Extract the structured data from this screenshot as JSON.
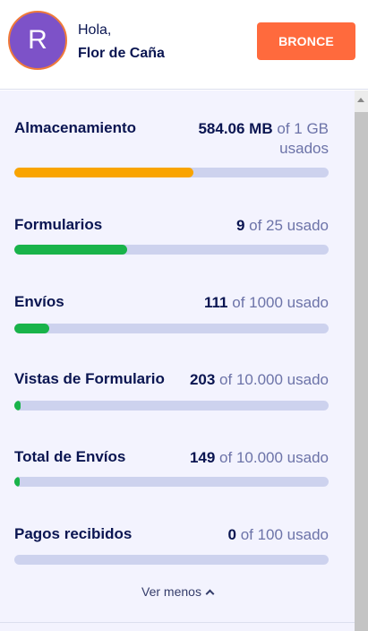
{
  "header": {
    "avatar_initial": "R",
    "greeting": "Hola,",
    "user_name": "Flor de Caña",
    "plan_label": "BRONCE"
  },
  "usage": [
    {
      "label": "Almacenamiento",
      "value": "584.06 MB",
      "suffix": "of 1 GB",
      "suffix2": "usados",
      "fraction": 0.57,
      "color": "#f9a400"
    },
    {
      "label": "Formularios",
      "value": "9",
      "suffix": "of 25 usado",
      "fraction": 0.36,
      "color": "#19b34a"
    },
    {
      "label": "Envíos",
      "value": "111",
      "suffix": "of 1000 usado",
      "fraction": 0.111,
      "color": "#19b34a"
    },
    {
      "label": "Vistas de Formulario",
      "value": "203",
      "suffix": "of 10.000 usado",
      "fraction": 0.0203,
      "color": "#19b34a"
    },
    {
      "label": "Total de Envíos",
      "value": "149",
      "suffix": "of 10.000 usado",
      "fraction": 0.0149,
      "color": "#19b34a"
    },
    {
      "label": "Pagos recibidos",
      "value": "0",
      "suffix": "of 100 usado",
      "fraction": 0,
      "color": "#19b34a"
    }
  ],
  "footer": {
    "toggle_label": "Ver menos"
  },
  "colors": {
    "accent": "#ff6a3d",
    "avatar_bg": "#7d52c8",
    "track": "#cdd2ee",
    "text_dark": "#0a1551",
    "text_muted": "#6c73a8"
  },
  "icons": {
    "toggle": "chevron-up-icon"
  }
}
